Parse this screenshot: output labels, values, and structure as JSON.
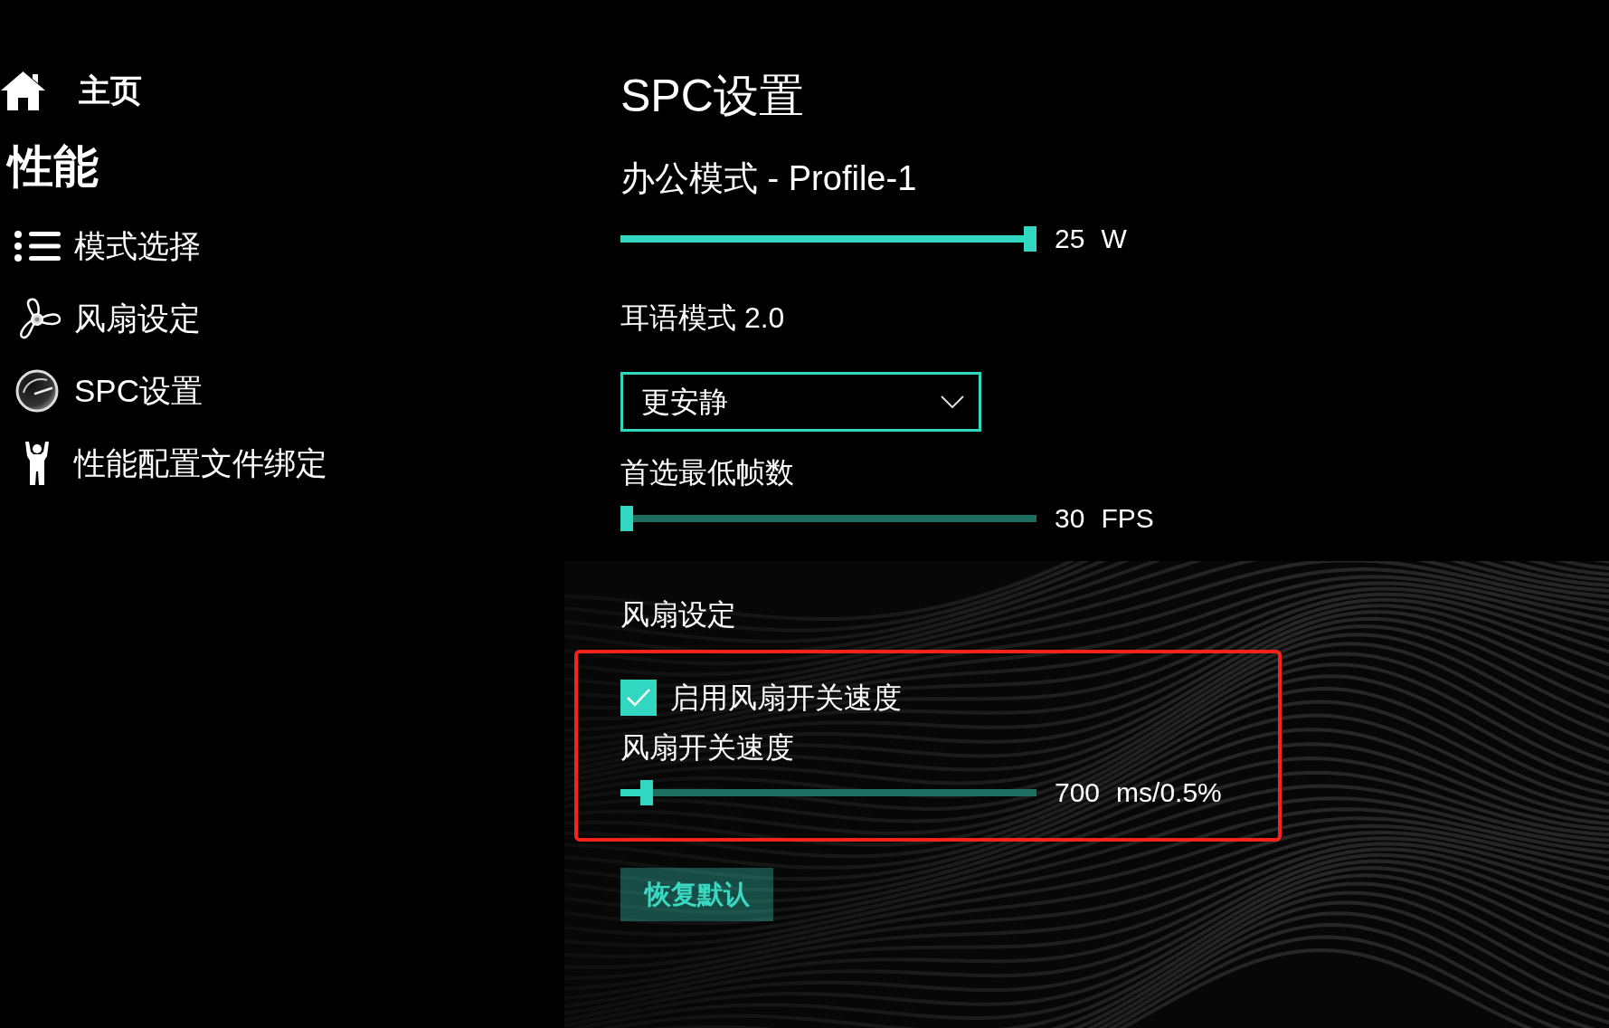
{
  "sidebar": {
    "home": {
      "label": "主页"
    },
    "section_title": "性能",
    "items": [
      {
        "label": "模式选择"
      },
      {
        "label": "风扇设定"
      },
      {
        "label": "SPC设置"
      },
      {
        "label": "性能配置文件绑定"
      }
    ]
  },
  "page_title": "SPC设置",
  "power_limit": {
    "label": "办公模式 - Profile-1",
    "level": 1,
    "value": "25",
    "unit": "W"
  },
  "whisper_mode": {
    "label": "耳语模式 2.0",
    "dropdown": {
      "value": "更安静"
    }
  },
  "min_fps": {
    "label": "首选最低帧数",
    "level": 0,
    "value": "30",
    "unit": "FPS"
  },
  "fan_settings": {
    "heading": "风扇设定",
    "highlighted": true,
    "enable_checkbox": {
      "label": "启用风扇开关速度",
      "checked": true
    },
    "switch_speed": {
      "label": "风扇开关速度",
      "level": 0.05,
      "value": "700",
      "unit": "ms/0.5%"
    }
  },
  "buttons": [
    {
      "label": "恢复默认"
    }
  ]
}
